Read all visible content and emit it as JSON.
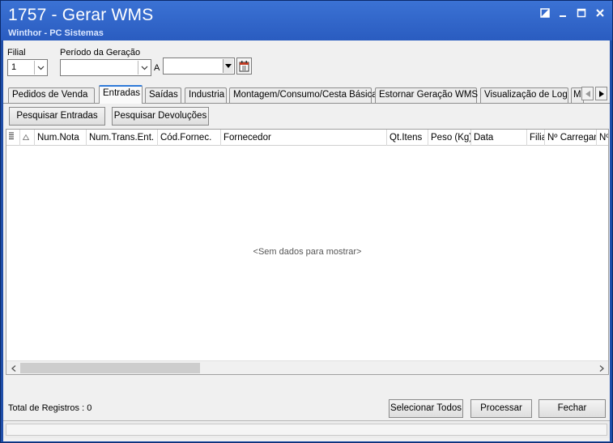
{
  "window": {
    "title": "1757 - Gerar WMS",
    "subtitle": "Winthor - PC Sistemas"
  },
  "filters": {
    "filial_label": "Filial",
    "filial_value": "1",
    "periodo_label": "Período da Geração",
    "periodo_from": "",
    "periodo_sep": "A",
    "periodo_to": ""
  },
  "tabs": [
    {
      "label": "Pedidos de Venda"
    },
    {
      "label": "Entradas"
    },
    {
      "label": "Saídas"
    },
    {
      "label": "Industria"
    },
    {
      "label": "Montagem/Consumo/Cesta Básica"
    },
    {
      "label": "Estornar Geração WMS"
    },
    {
      "label": "Visualização de Log"
    },
    {
      "label": "M"
    }
  ],
  "actions": {
    "pesquisar_entradas": "Pesquisar Entradas",
    "pesquisar_devolucoes": "Pesquisar Devoluções"
  },
  "grid": {
    "columns": [
      "Num.Nota",
      "Num.Trans.Ent.",
      "Cód.Fornec.",
      "Fornecedor",
      "Qt.Itens",
      "Peso (Kg)",
      "Data",
      "Filia",
      "Nº Carregam",
      "Nº"
    ],
    "empty_message": "<Sem dados para mostrar>"
  },
  "footer": {
    "total_label": "Total de Registros :",
    "total_value": "0",
    "selecionar_todos": "Selecionar Todos",
    "processar": "Processar",
    "fechar": "Fechar"
  }
}
